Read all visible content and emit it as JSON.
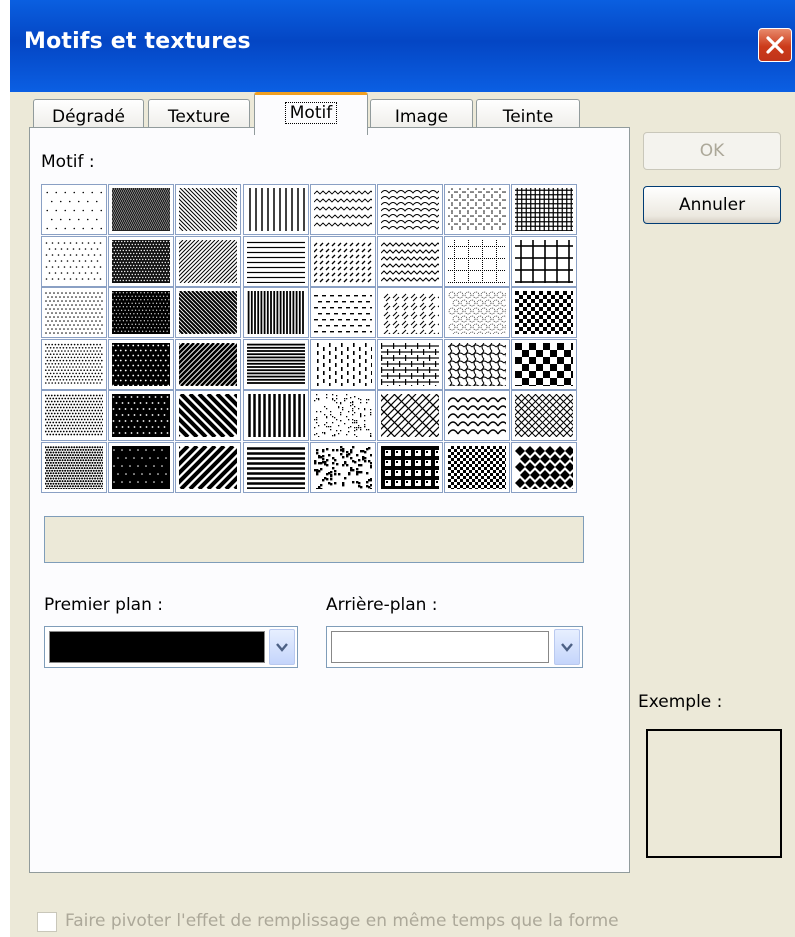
{
  "window": {
    "title": "Motifs et textures"
  },
  "tabs": [
    {
      "label": "Dégradé"
    },
    {
      "label": "Texture"
    },
    {
      "label": "Motif",
      "active": true
    },
    {
      "label": "Image"
    },
    {
      "label": "Teinte"
    }
  ],
  "motif_panel": {
    "motif_label": "Motif :",
    "patterns": [
      "dots-5",
      "dots-50",
      "wide-down-diagonal",
      "light-vertical",
      "small-wave",
      "wave",
      "dotted-diamond",
      "small-grid",
      "dots-10",
      "dots-60",
      "wide-up-diagonal",
      "light-horizontal",
      "dashed-up-diagonal",
      "zigzag",
      "dotted-grid",
      "large-grid",
      "dots-20",
      "dots-70",
      "dark-down-diagonal",
      "dark-vertical",
      "dashed-horizontal",
      "divot",
      "sphere",
      "small-checker",
      "dots-25",
      "dots-75",
      "dark-up-diagonal",
      "dark-horizontal",
      "dashed-vertical",
      "horizontal-brick",
      "weave",
      "large-checker",
      "dots-30",
      "dots-80",
      "wide-dark-down-diagonal",
      "narrow-vertical",
      "small-confetti",
      "diagonal-brick",
      "shingle",
      "outlined-diamond",
      "dots-40",
      "dots-90",
      "wide-dark-up-diagonal",
      "narrow-horizontal",
      "large-confetti",
      "plaid",
      "trellis",
      "solid-diamond"
    ],
    "pattern_name": "",
    "foreground_label": "Premier plan :",
    "background_label": "Arrière-plan :",
    "foreground_color": "#000000",
    "background_color": "#ffffff"
  },
  "buttons": {
    "ok": "OK",
    "cancel": "Annuler"
  },
  "example_label": "Exemple :",
  "rotate_checkbox": {
    "label": "Faire pivoter l'effet de remplissage en même temps que la forme",
    "checked": false,
    "enabled": false
  },
  "icons": {
    "close": "close-icon",
    "dropdown": "chevron-down-icon"
  }
}
